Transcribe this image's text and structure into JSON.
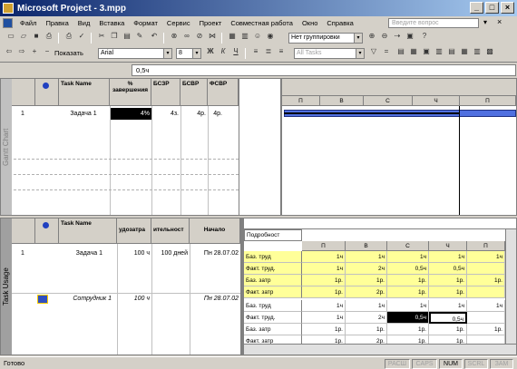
{
  "window": {
    "title": "Microsoft Project - 3.mpp"
  },
  "menu": {
    "items": [
      "Файл",
      "Правка",
      "Вид",
      "Вставка",
      "Формат",
      "Сервис",
      "Проект",
      "Совместная работа",
      "Окно",
      "Справка"
    ],
    "help_placeholder": "Введите вопрос"
  },
  "toolbar1": {
    "group_combo": "Нет группировки"
  },
  "toolbar2": {
    "show_label": "Показать",
    "font": "Arial",
    "size": "8",
    "bold": "Ж",
    "italic": "К",
    "underline": "Ч",
    "filter": "All Tasks"
  },
  "entry_bar": {
    "value": "0,5ч"
  },
  "gantt": {
    "side_label": "Gantt Chart",
    "columns": [
      "Task Name",
      "% завершения",
      "БСЗР",
      "БСВР",
      "ФСВР"
    ],
    "rows": [
      {
        "id": "1",
        "name": "Задача 1",
        "percent": "4%",
        "bszr": "4з.",
        "bsvr": "4р.",
        "fsvr": "4р."
      }
    ],
    "timescale_days": [
      "П",
      "В",
      "С",
      "Ч",
      "П"
    ]
  },
  "usage": {
    "side_label": "Task Usage",
    "columns": [
      "Task Name",
      "удозатра",
      "ительност",
      "Начало"
    ],
    "rows": [
      {
        "id": "1",
        "name": "Задача 1",
        "work": "100 ч",
        "duration": "100 дней",
        "start": "Пн 28.07.02"
      },
      {
        "id": "",
        "name": "Сотрудник 1",
        "work": "100 ч",
        "duration": "",
        "start": "Пн 28.07.02"
      }
    ],
    "details_label": "Подробност",
    "timescale_days": [
      "П",
      "В",
      "С",
      "Ч",
      "П"
    ],
    "grid": [
      {
        "label": "Баз. труд",
        "vals": [
          "1ч",
          "1ч",
          "1ч",
          "1ч",
          "1ч"
        ],
        "yellow": true
      },
      {
        "label": "Факт. труд.",
        "vals": [
          "1ч",
          "2ч",
          "0,5ч",
          "0,5ч",
          ""
        ],
        "yellow": true
      },
      {
        "label": "Баз. затр",
        "vals": [
          "1р.",
          "1р.",
          "1р.",
          "1р.",
          "1р."
        ],
        "yellow": true
      },
      {
        "label": "Факт. затр",
        "vals": [
          "1р.",
          "2р.",
          "1р.",
          "1р.",
          ""
        ],
        "yellow": true
      },
      {
        "label": "Баз. труд",
        "vals": [
          "1ч",
          "1ч",
          "1ч",
          "1ч",
          "1ч"
        ],
        "yellow": false
      },
      {
        "label": "Факт. труд.",
        "vals": [
          "1ч",
          "2ч",
          "0,5ч",
          "0,5ч",
          ""
        ],
        "yellow": false
      },
      {
        "label": "Баз. затр",
        "vals": [
          "1р.",
          "1р.",
          "1р.",
          "1р.",
          "1р."
        ],
        "yellow": false
      },
      {
        "label": "Факт. затр",
        "vals": [
          "1р.",
          "2р.",
          "1р.",
          "1р.",
          ""
        ],
        "yellow": false
      }
    ]
  },
  "status": {
    "ready": "Готово",
    "indicators": [
      "РАСШ",
      "CAPS",
      "NUM",
      "SCRL",
      "ЗАМ"
    ]
  }
}
